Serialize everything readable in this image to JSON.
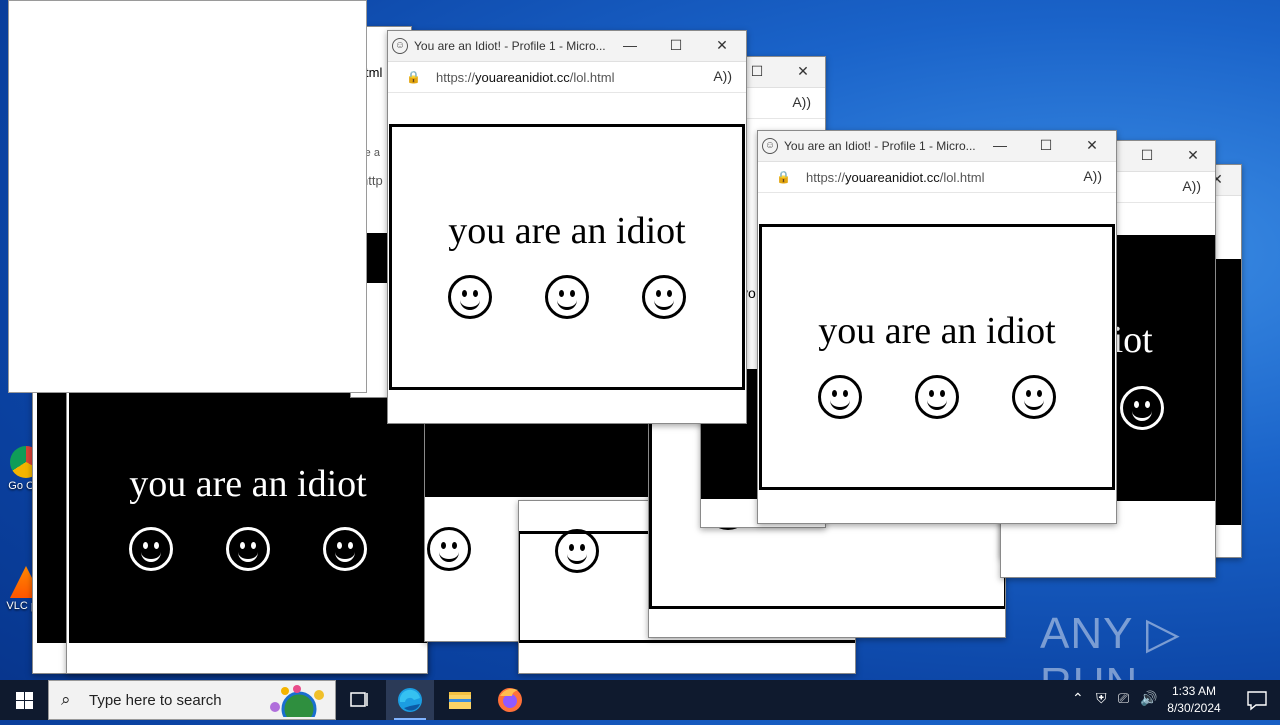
{
  "desktop": {
    "icons": [
      {
        "name": "google-chrome",
        "label": "Go Chr"
      },
      {
        "name": "vlc",
        "label": "VLC pla"
      }
    ],
    "watermark": "ANY ▷ RUN"
  },
  "popup": {
    "title": "You are an Idiot! - Profile 1 - Micro...",
    "url_prefix": "https://",
    "url_domain": "youareanidiot.cc",
    "url_path": "/lol.html",
    "message": "you are an idiot",
    "minimize_glyph": "—",
    "maximize_glyph": "☐",
    "close_glyph": "✕",
    "read_aloud_glyph": "A))"
  },
  "background_fragments": {
    "partial_title": "re a",
    "partial_url": "http",
    "partial_url2": "tml",
    "partial_text": "vo"
  },
  "taskbar": {
    "search_placeholder": "Type here to search",
    "pinned": [
      {
        "name": "task-view",
        "active": false
      },
      {
        "name": "microsoft-edge",
        "active": true
      },
      {
        "name": "file-explorer",
        "active": false
      },
      {
        "name": "firefox",
        "active": false
      }
    ],
    "time": "1:33 AM",
    "date": "8/30/2024"
  },
  "colors": {
    "accent": "#0078d7",
    "taskbar": "#0f1a2e"
  }
}
